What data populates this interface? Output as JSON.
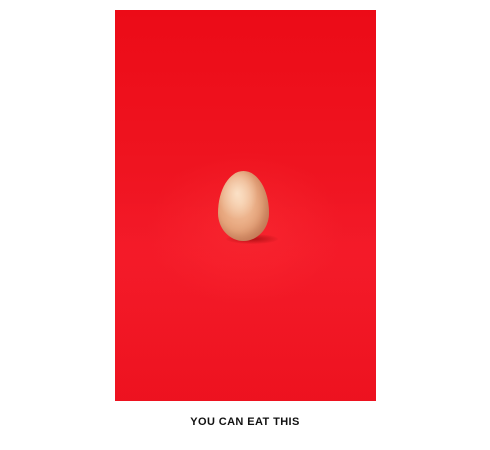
{
  "photo": {
    "description_icon": "egg-photo",
    "background_color": "#ef1420",
    "egg_color": "#e7a57c"
  },
  "caption": {
    "text": "YOU CAN EAT THIS"
  }
}
